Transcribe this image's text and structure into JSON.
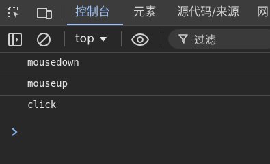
{
  "tabbar": {
    "inspect_icon": "inspect-element-icon",
    "device_icon": "device-toolbar-icon",
    "tabs": [
      {
        "label": "控制台",
        "active": true
      },
      {
        "label": "元素",
        "active": false
      },
      {
        "label": "源代码/来源",
        "active": false
      },
      {
        "label": "网",
        "active": false
      }
    ]
  },
  "toolbar": {
    "sidebar_icon": "sidebar-toggle-icon",
    "clear_icon": "clear-console-icon",
    "context": "top",
    "eye_icon": "live-expression-icon",
    "filter_placeholder": "过滤",
    "filter_icon": "filter-icon"
  },
  "console": {
    "messages": [
      "mousedown",
      "mouseup",
      "click"
    ],
    "prompt_icon": "prompt-chevron-icon"
  },
  "colors": {
    "background": "#282828",
    "tabbar": "#3c3c3c",
    "accent": "#9ec2f7",
    "prompt": "#8ab4f8"
  }
}
